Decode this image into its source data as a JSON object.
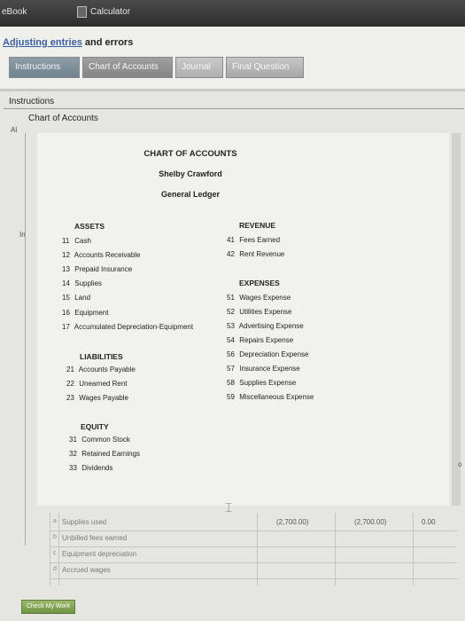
{
  "topbar": {
    "ebook": "eBook",
    "calculator": "Calculator"
  },
  "title": {
    "link": "Adjusting entries",
    "rest": " and errors"
  },
  "tabs": [
    {
      "label": "Instructions"
    },
    {
      "label": "Chart of Accounts"
    },
    {
      "label": "Journal"
    },
    {
      "label": "Final Question"
    }
  ],
  "panel": {
    "instructions": "Instructions",
    "chart_of_accounts": "Chart of Accounts",
    "al": "Al",
    "in": "In"
  },
  "doc": {
    "heading": "CHART OF ACCOUNTS",
    "name": "Shelby Crawford",
    "ledger": "General Ledger",
    "assets": {
      "title": "ASSETS",
      "items": [
        {
          "num": "11",
          "name": "Cash"
        },
        {
          "num": "12",
          "name": "Accounts Receivable"
        },
        {
          "num": "13",
          "name": "Prepaid Insurance"
        },
        {
          "num": "14",
          "name": "Supplies"
        },
        {
          "num": "15",
          "name": "Land"
        },
        {
          "num": "16",
          "name": "Equipment"
        },
        {
          "num": "17",
          "name": "Accumulated Depreciation-Equipment"
        }
      ]
    },
    "liabilities": {
      "title": "LIABILITIES",
      "items": [
        {
          "num": "21",
          "name": "Accounts Payable"
        },
        {
          "num": "22",
          "name": "Unearned Rent"
        },
        {
          "num": "23",
          "name": "Wages Payable"
        }
      ]
    },
    "equity": {
      "title": "EQUITY",
      "items": [
        {
          "num": "31",
          "name": "Common Stock"
        },
        {
          "num": "32",
          "name": "Retained Earnings"
        },
        {
          "num": "33",
          "name": "Dividends"
        }
      ]
    },
    "revenue": {
      "title": "REVENUE",
      "items": [
        {
          "num": "41",
          "name": "Fees Earned"
        },
        {
          "num": "42",
          "name": "Rent Revenue"
        }
      ]
    },
    "expenses": {
      "title": "EXPENSES",
      "items": [
        {
          "num": "51",
          "name": "Wages Expense"
        },
        {
          "num": "52",
          "name": "Utilities Expense"
        },
        {
          "num": "53",
          "name": "Advertising Expense"
        },
        {
          "num": "54",
          "name": "Repairs Expense"
        },
        {
          "num": "56",
          "name": "Depreciation Expense"
        },
        {
          "num": "57",
          "name": "Insurance Expense"
        },
        {
          "num": "58",
          "name": "Supplies Expense"
        },
        {
          "num": "59",
          "name": "Miscellaneous Expense"
        }
      ]
    }
  },
  "grid_rows": [
    {
      "marker": "a",
      "desc": "Supplies used",
      "v1": "(2,700.00)",
      "v2": "(2,700.00)",
      "v3": "0.00"
    },
    {
      "marker": "b",
      "desc": "Unbilled fees earned",
      "v1": "",
      "v2": "",
      "v3": ""
    },
    {
      "marker": "c",
      "desc": "Equipment depreciation",
      "v1": "",
      "v2": "",
      "v3": ""
    },
    {
      "marker": "d",
      "desc": "Accrued wages",
      "v1": "",
      "v2": "",
      "v3": ""
    }
  ],
  "buttons": {
    "check": "Check My Work"
  },
  "edge": {
    "o": "o"
  }
}
